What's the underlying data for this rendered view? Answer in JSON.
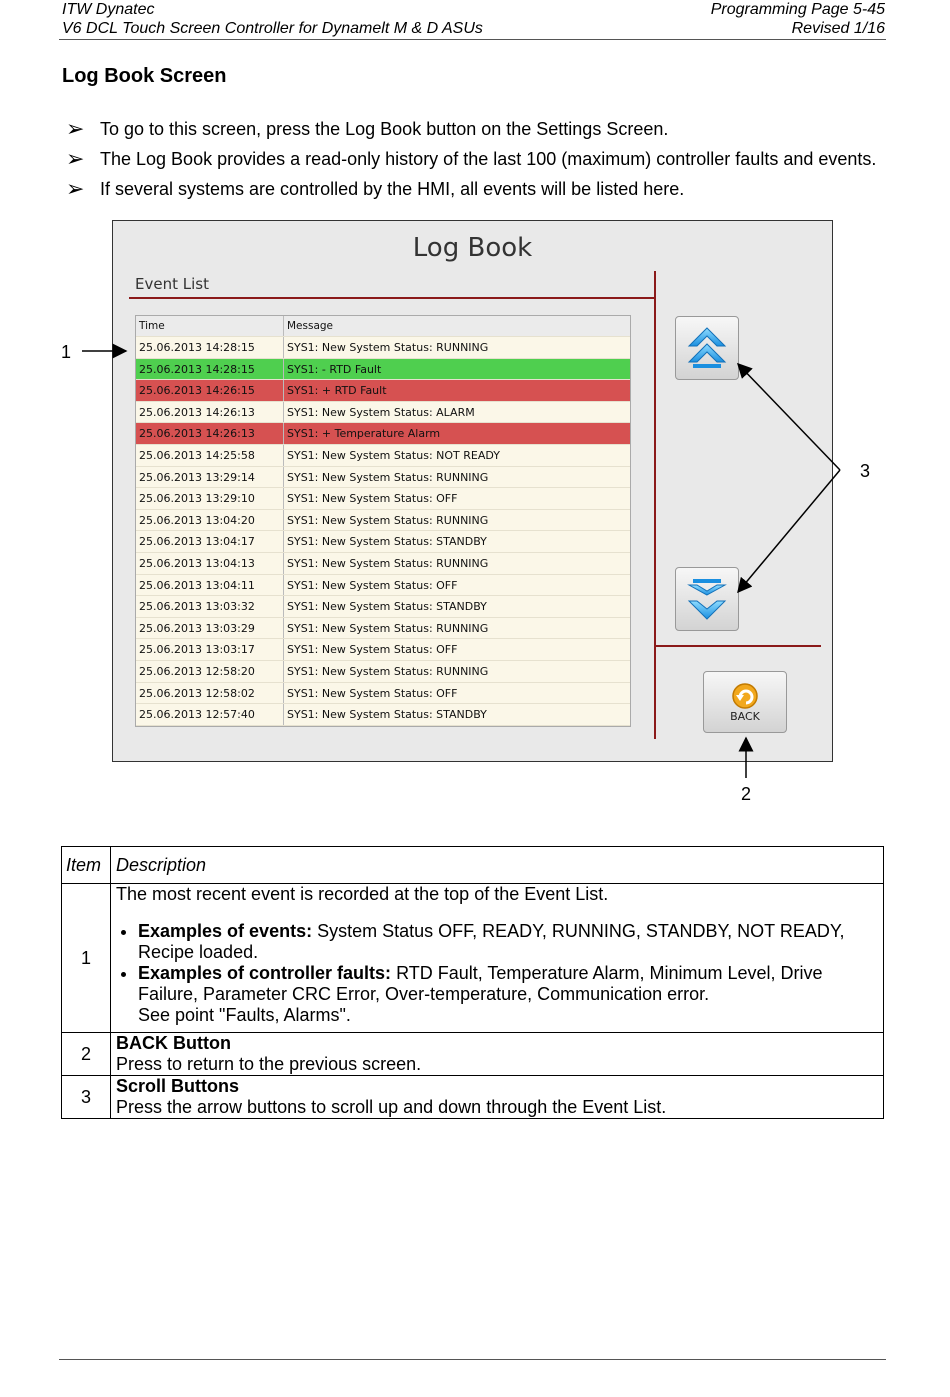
{
  "header": {
    "company": "ITW Dynatec",
    "manual": "V6 DCL Touch Screen Controller for Dynamelt M & D ASUs",
    "page": "Programming Page 5-45",
    "revision": "Revised 1/16"
  },
  "section_title": "Log Book Screen",
  "bullets": [
    "To go to this screen, press the Log Book button on the Settings Screen.",
    "The Log Book provides a read-only history of the last 100 (maximum) controller faults and events.",
    "If several systems are controlled by the HMI, all events will be listed here."
  ],
  "screen": {
    "title": "Log Book",
    "event_list_label": "Event List",
    "columns": [
      "Time",
      "Message"
    ],
    "rows": [
      {
        "time": "25.06.2013   14:28:15",
        "message": "SYS1: New System Status: RUNNING",
        "color": "#fbf7e8"
      },
      {
        "time": "25.06.2013   14:28:15",
        "message": "SYS1: - RTD Fault",
        "color": "#4fcf4f"
      },
      {
        "time": "25.06.2013   14:26:15",
        "message": "SYS1: + RTD Fault",
        "color": "#d65151"
      },
      {
        "time": "25.06.2013   14:26:13",
        "message": "SYS1: New System Status: ALARM",
        "color": "#fbf7e8"
      },
      {
        "time": "25.06.2013   14:26:13",
        "message": "SYS1: + Temperature Alarm",
        "color": "#d65151"
      },
      {
        "time": "25.06.2013   14:25:58",
        "message": "SYS1: New System Status: NOT READY",
        "color": "#fbf7e8"
      },
      {
        "time": "25.06.2013   13:29:14",
        "message": "SYS1: New System Status: RUNNING",
        "color": "#fbf7e8"
      },
      {
        "time": "25.06.2013   13:29:10",
        "message": "SYS1: New System Status: OFF",
        "color": "#fbf7e8"
      },
      {
        "time": "25.06.2013   13:04:20",
        "message": "SYS1: New System Status: RUNNING",
        "color": "#fbf7e8"
      },
      {
        "time": "25.06.2013   13:04:17",
        "message": "SYS1: New System Status: STANDBY",
        "color": "#fbf7e8"
      },
      {
        "time": "25.06.2013   13:04:13",
        "message": "SYS1: New System Status: RUNNING",
        "color": "#fbf7e8"
      },
      {
        "time": "25.06.2013   13:04:11",
        "message": "SYS1: New System Status: OFF",
        "color": "#fbf7e8"
      },
      {
        "time": "25.06.2013   13:03:32",
        "message": "SYS1: New System Status: STANDBY",
        "color": "#fbf7e8"
      },
      {
        "time": "25.06.2013   13:03:29",
        "message": "SYS1: New System Status: RUNNING",
        "color": "#fbf7e8"
      },
      {
        "time": "25.06.2013   13:03:17",
        "message": "SYS1: New System Status: OFF",
        "color": "#fbf7e8"
      },
      {
        "time": "25.06.2013   12:58:20",
        "message": "SYS1: New System Status: RUNNING",
        "color": "#fbf7e8"
      },
      {
        "time": "25.06.2013   12:58:02",
        "message": "SYS1: New System Status: OFF",
        "color": "#fbf7e8"
      },
      {
        "time": "25.06.2013   12:57:40",
        "message": "SYS1: New System Status: STANDBY",
        "color": "#fbf7e8"
      }
    ],
    "back_label": "BACK",
    "scroll_up_icon": "double-chevron-up-icon",
    "scroll_down_icon": "double-chevron-down-icon"
  },
  "callouts": {
    "one": "1",
    "two": "2",
    "three": "3"
  },
  "table": {
    "col_item": "Item",
    "col_description": "Description",
    "row1": {
      "item": "1",
      "intro": "The most recent event is recorded at the top of the Event List.",
      "b1_bold": "Examples of events:",
      "b1_text": " System Status OFF, READY, RUNNING, STANDBY, NOT READY, Recipe loaded.",
      "b2_bold": "Examples of controller faults:",
      "b2_text": " RTD Fault, Temperature Alarm, Minimum Level, Drive Failure, Parameter CRC Error, Over-temperature, Communication error.",
      "b2_see": "See point \"Faults, Alarms\"."
    },
    "row2": {
      "item": "2",
      "title": "BACK Button",
      "text": "Press to return to the previous screen."
    },
    "row3": {
      "item": "3",
      "title": "Scroll Buttons",
      "text": "Press the arrow buttons to scroll up and down through the Event List."
    }
  }
}
